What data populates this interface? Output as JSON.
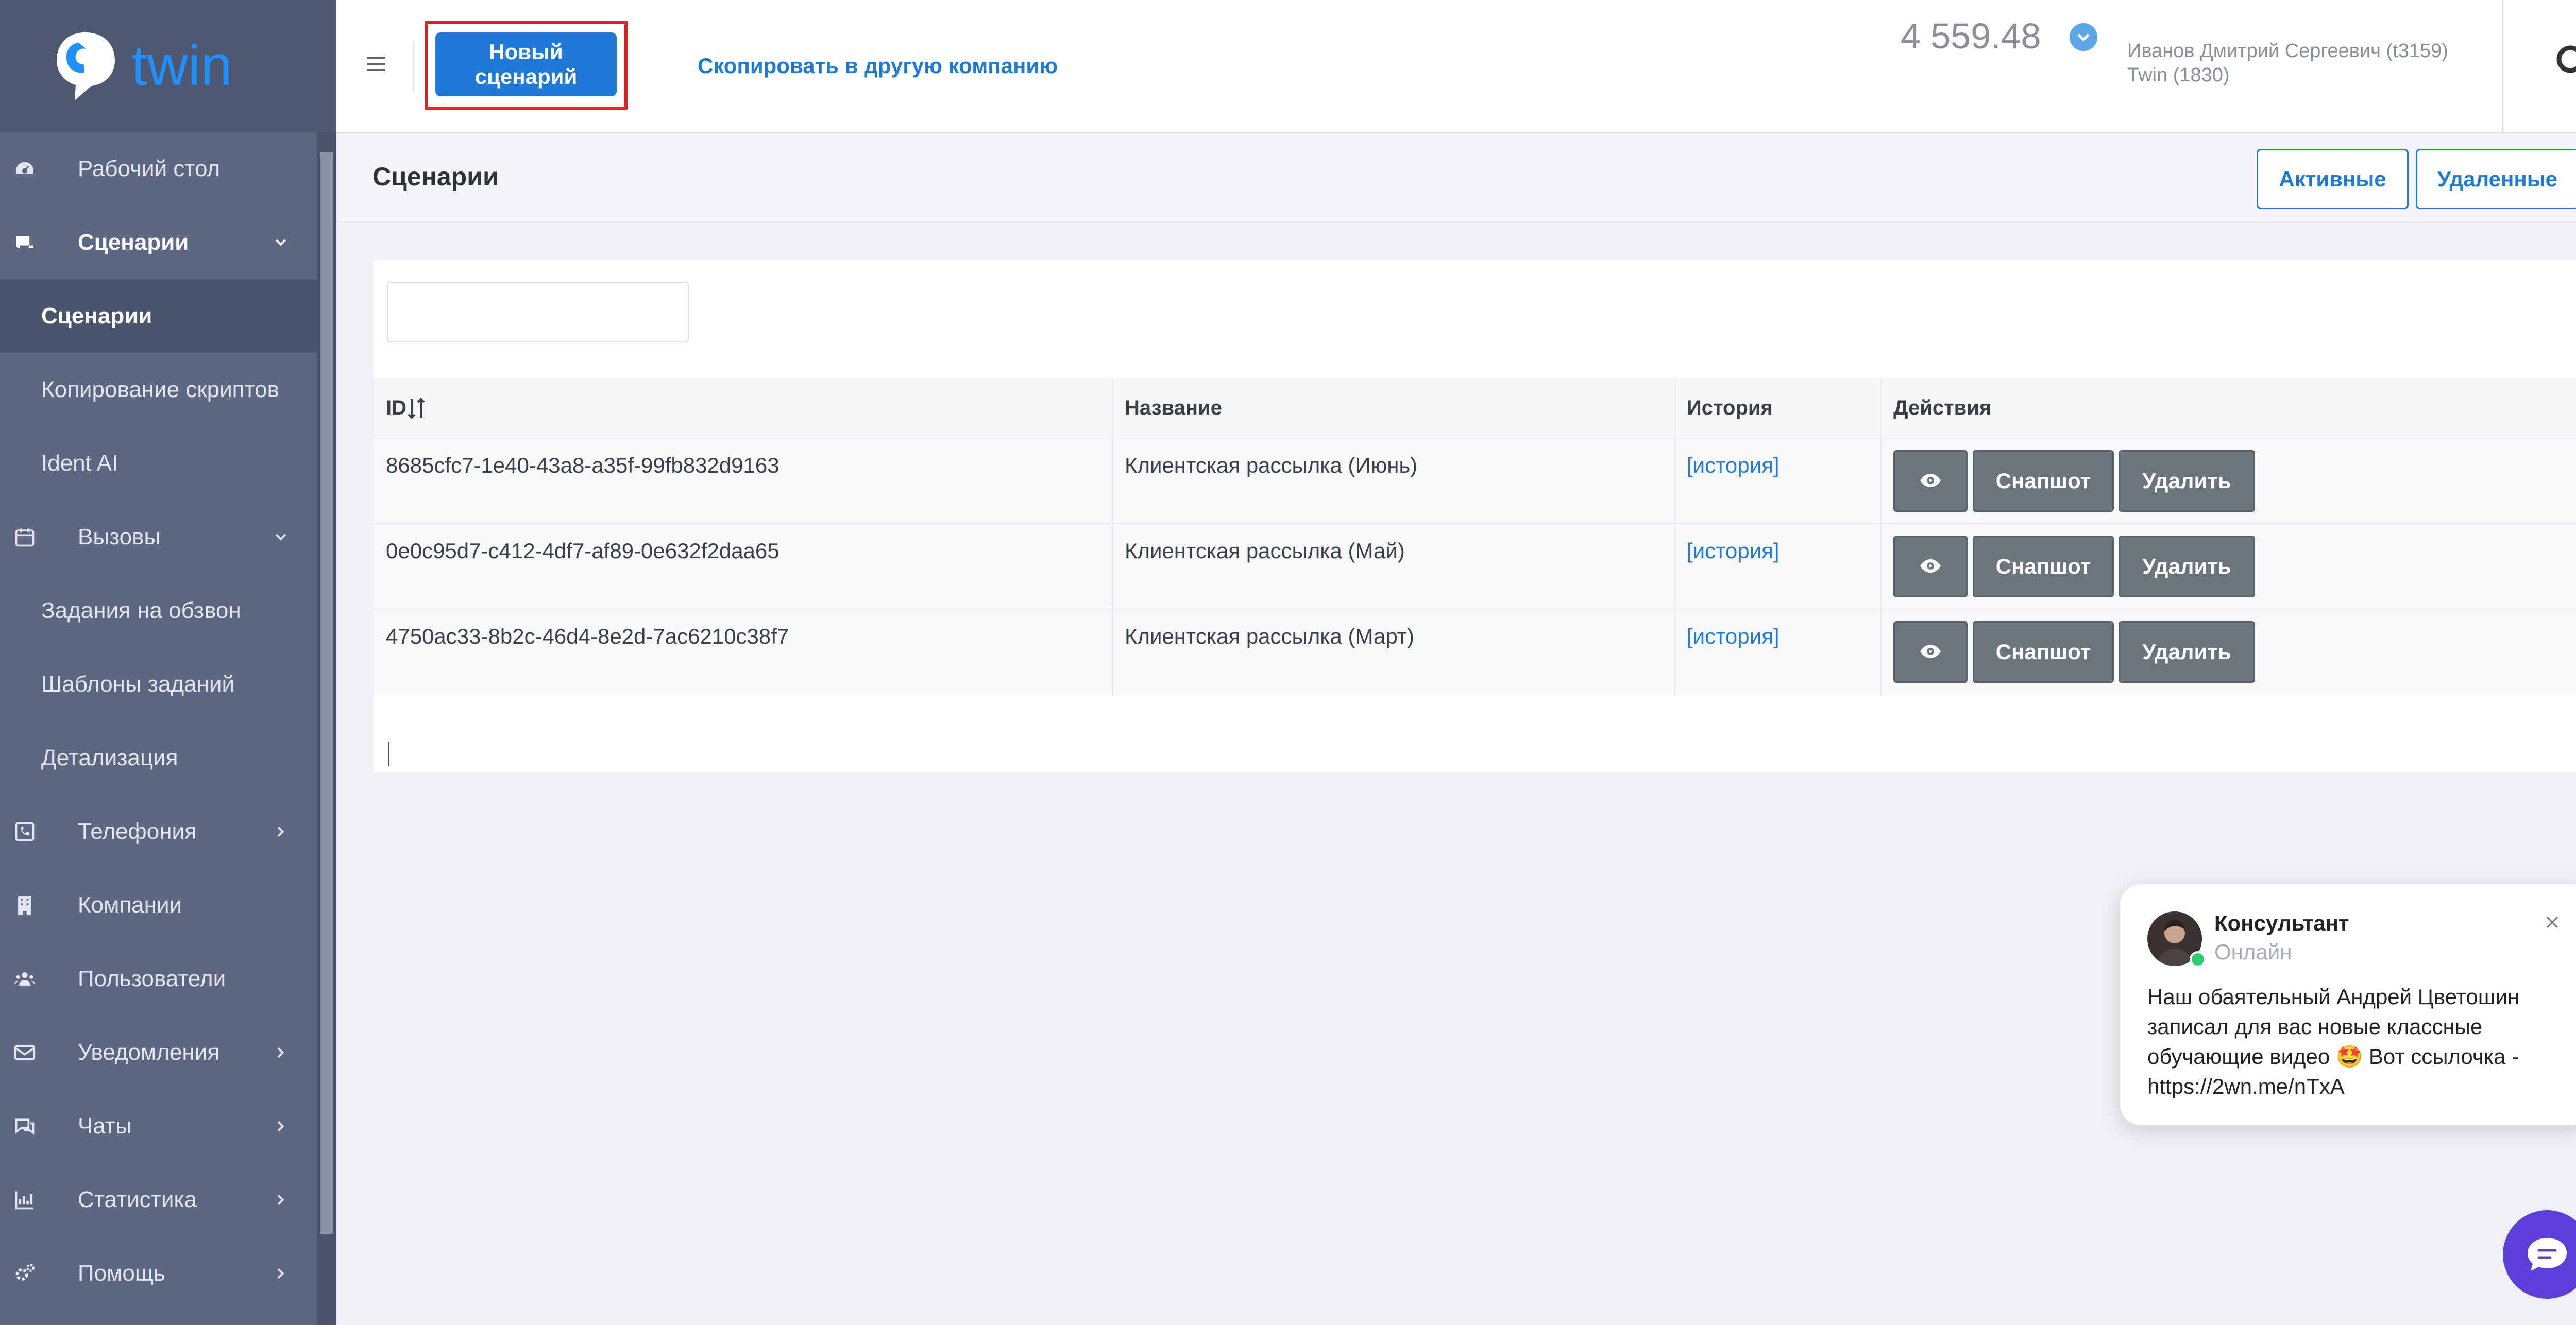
{
  "brand": {
    "name": "twin"
  },
  "sidebar": {
    "items": [
      {
        "label": "Рабочий стол",
        "icon": "dashboard-icon"
      },
      {
        "label": "Сценарии",
        "icon": "scenarios-icon",
        "expanded": true
      },
      {
        "label": "Вызовы",
        "icon": "calendar-icon",
        "expanded": true
      },
      {
        "label": "Телефония",
        "icon": "phone-icon"
      },
      {
        "label": "Компании",
        "icon": "building-icon"
      },
      {
        "label": "Пользователи",
        "icon": "users-icon"
      },
      {
        "label": "Уведомления",
        "icon": "envelope-icon"
      },
      {
        "label": "Чаты",
        "icon": "chat-icon"
      },
      {
        "label": "Статистика",
        "icon": "chart-icon"
      },
      {
        "label": "Помощь",
        "icon": "gears-icon"
      }
    ],
    "sub_scenarios": [
      "Сценарии",
      "Копирование скриптов",
      "Ident AI"
    ],
    "sub_calls": [
      "Задания на обзвон",
      "Шаблоны заданий",
      "Детализация"
    ]
  },
  "topbar": {
    "new_scenario": "Новый сценарий",
    "copy_link": "Скопировать в другую компанию",
    "balance": "4 559.48",
    "user_name": "Иванов Дмитрий Сергеевич (t3159)",
    "user_company": "Twin (1830)"
  },
  "page": {
    "title": "Сценарии",
    "btn_active": "Активные",
    "btn_deleted": "Удаленные",
    "search_value": ""
  },
  "table": {
    "headers": [
      "ID",
      "Название",
      "История",
      "Действия"
    ],
    "rows": [
      {
        "id": "8685cfc7-1e40-43a8-a35f-99fb832d9163",
        "name": "Клиентская рассылка (Июнь)",
        "history": "[история]"
      },
      {
        "id": "0e0c95d7-c412-4df7-af89-0e632f2daa65",
        "name": "Клиентская рассылка (Май)",
        "history": "[история]"
      },
      {
        "id": "4750ac33-8b2c-46d4-8e2d-7ac6210c38f7",
        "name": "Клиентская рассылка (Март)",
        "history": "[история]"
      }
    ],
    "actions": {
      "snapshot": "Снапшот",
      "delete": "Удалить"
    }
  },
  "chat": {
    "name": "Консультант",
    "status": "Онлайн",
    "message": "Наш обаятельный Андрей Цветошин записал для вас новые классные обучающие видео 🤩 Вот ссылочка - https://2wn.me/nTxA"
  },
  "colors": {
    "accent": "#1e7ad6",
    "sidebar": "#5d6783",
    "action": "#6c757d",
    "chat_fab": "#5b3fd8"
  }
}
